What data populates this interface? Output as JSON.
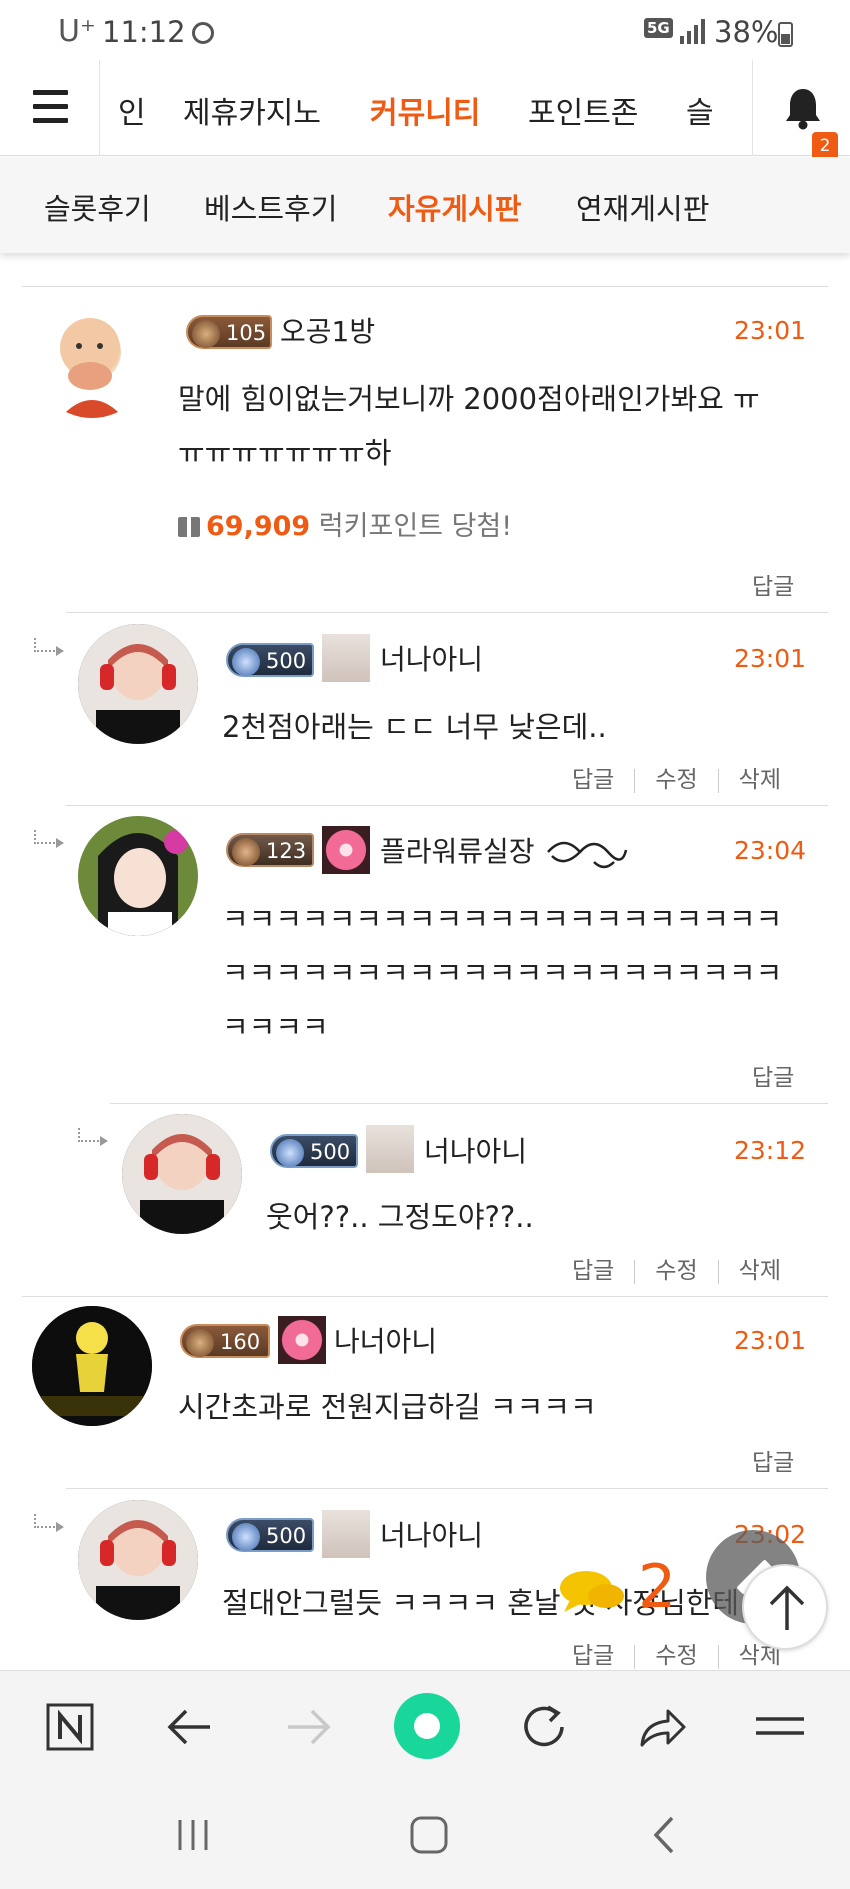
{
  "status_bar": {
    "carrier": "U⁺",
    "time": "11:12",
    "network": "5G",
    "battery": "38%"
  },
  "top_nav": {
    "items": [
      "인",
      "제휴카지노",
      "커뮤니티",
      "포인트존",
      "슬"
    ],
    "active": "커뮤니티",
    "notification_count": "2"
  },
  "sub_nav": {
    "items": [
      "슬롯후기",
      "베스트후기",
      "자유게시판",
      "연재게시판"
    ],
    "active": "자유게시판"
  },
  "comments": [
    {
      "level": "105",
      "nickname": "오공1방",
      "time": "23:01",
      "text_line1": "말에 힘이없는거보니까 2000점아래인가봐요 ㅠ",
      "text_line2": "ㅠㅠㅠㅠㅠㅠㅠ하",
      "lucky_points": "69,909",
      "lucky_label": "럭키포인트 당첨!",
      "reply_label": "답글"
    },
    {
      "level": "500",
      "nickname": "너나아니",
      "time": "23:01",
      "text": "2천점아래는 ㄷㄷ 너무 낮은데..",
      "actions": [
        "답글",
        "수정",
        "삭제"
      ]
    },
    {
      "level": "123",
      "nickname": "플라워류실장",
      "time": "23:04",
      "text_line1": "ㅋㅋㅋㅋㅋㅋㅋㅋㅋㅋㅋㅋㅋㅋㅋㅋㅋㅋㅋㅋㅋ",
      "text_line2": "ㅋㅋㅋㅋㅋㅋㅋㅋㅋㅋㅋㅋㅋㅋㅋㅋㅋㅋㅋㅋㅋ",
      "text_line3": "ㅋㅋㅋㅋ",
      "reply_label": "답글"
    },
    {
      "level": "500",
      "nickname": "너나아니",
      "time": "23:12",
      "text": "웃어??.. 그정도야??..",
      "actions": [
        "답글",
        "수정",
        "삭제"
      ]
    },
    {
      "level": "160",
      "nickname": "나너아니",
      "time": "23:01",
      "text": "시간초과로 전원지급하길 ㅋㅋㅋㅋ",
      "reply_label": "답글"
    },
    {
      "level": "500",
      "nickname": "너나아니",
      "time": "23:02",
      "text": "절대안그럴듯 ㅋㅋㅋㅋ 혼날 것 사장님한테",
      "actions": [
        "답글",
        "수정",
        "삭제"
      ]
    }
  ],
  "floating": {
    "comment_count": "2"
  },
  "icons": {
    "menu": "hamburger-icon",
    "bell": "bell-icon",
    "browser": [
      "n-home-icon",
      "back-icon",
      "forward-icon",
      "home-circle-icon",
      "refresh-icon",
      "share-icon",
      "menu-lines-icon"
    ],
    "system": [
      "recents-icon",
      "home-icon",
      "system-back-icon"
    ]
  },
  "colors": {
    "accent": "#ef5b13",
    "green": "#19d69a"
  }
}
